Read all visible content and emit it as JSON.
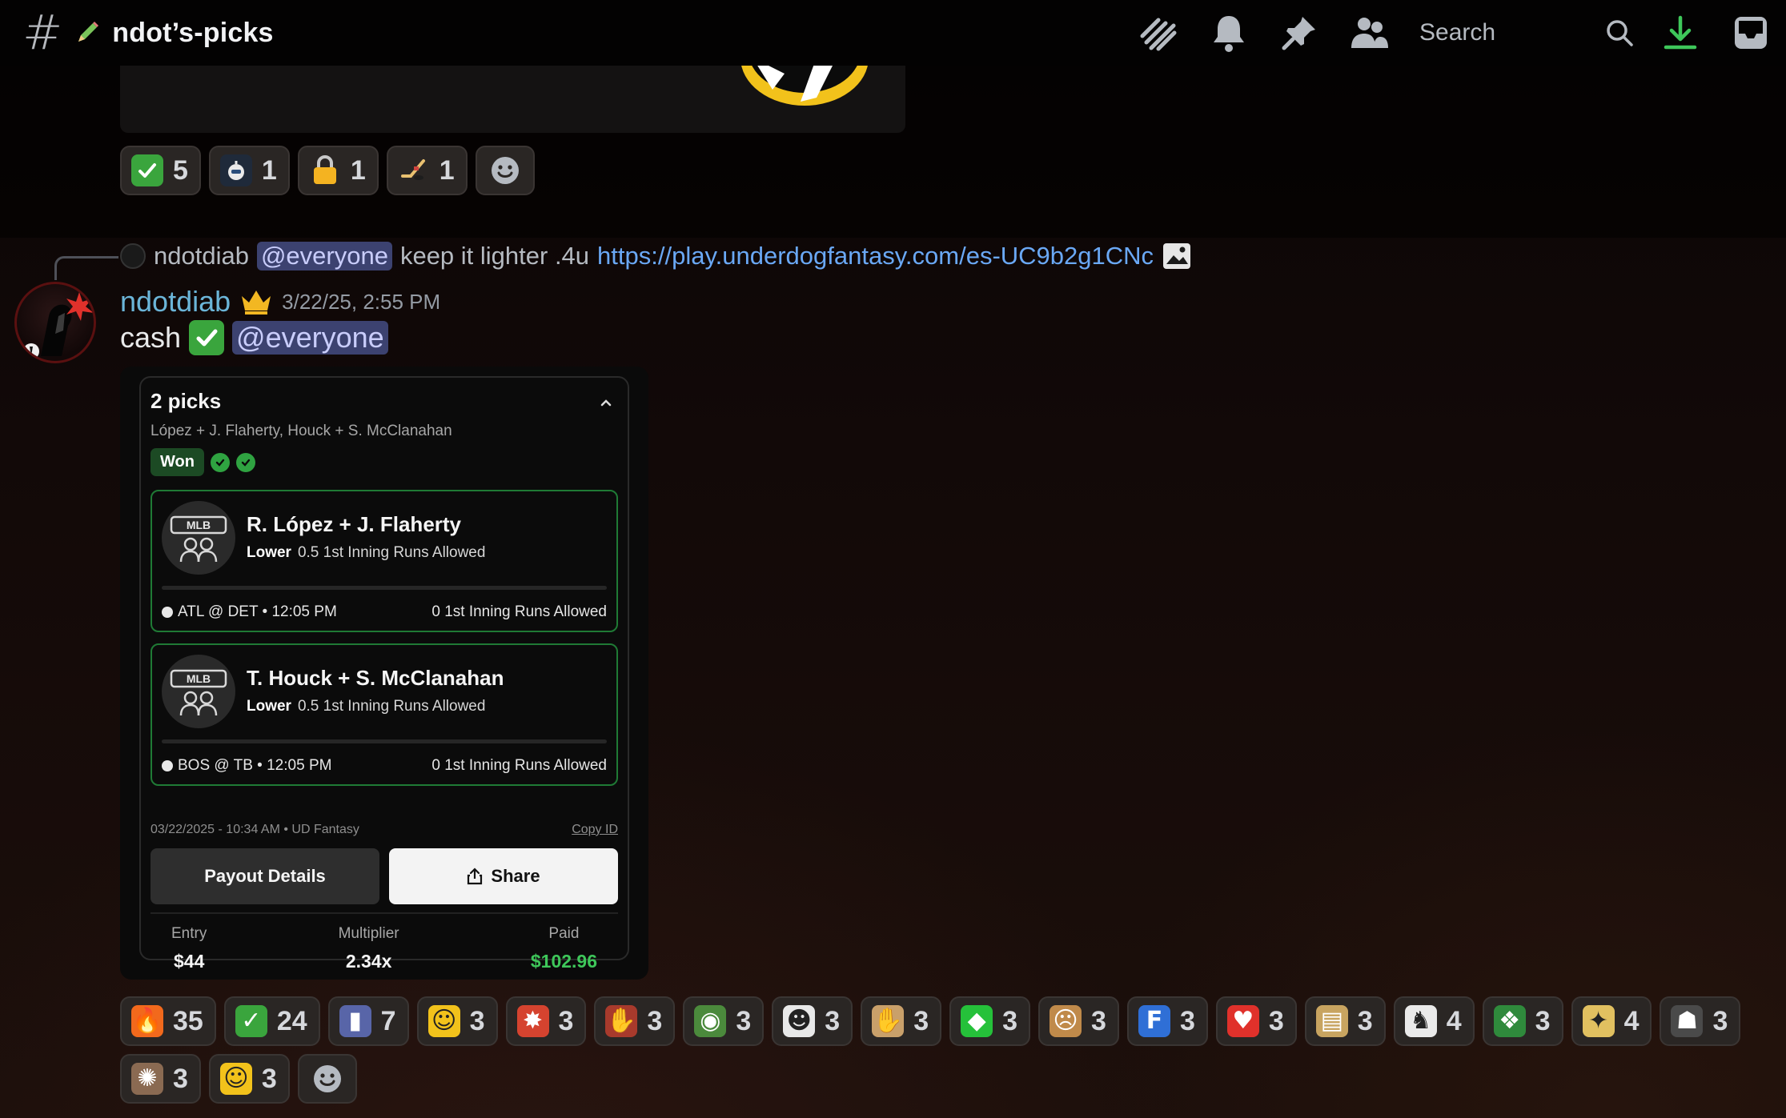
{
  "header": {
    "channel_name": "ndot’s-picks",
    "search_placeholder": "Search",
    "icons": [
      "threads-icon",
      "bell-icon",
      "pin-icon",
      "members-icon",
      "search-icon",
      "download-icon",
      "inbox-icon"
    ]
  },
  "prev_reactions": [
    {
      "icon": "check-mark-icon",
      "count": "5"
    },
    {
      "icon": "robot-icon",
      "count": "1"
    },
    {
      "icon": "lock-icon",
      "count": "1"
    },
    {
      "icon": "hockey-stick-icon",
      "count": "1"
    }
  ],
  "reply": {
    "author": "ndotdiab",
    "mention": "@everyone",
    "text": "keep it lighter .4u",
    "link": "https://play.underdogfantasy.com/es-UC9b2g1CNc"
  },
  "message": {
    "author": "ndotdiab",
    "timestamp": "3/22/25, 2:55 PM",
    "text": "cash",
    "mention": "@everyone"
  },
  "card": {
    "title": "2 picks",
    "subtitle": "López + J. Flaherty, Houck + S. McClanahan",
    "status": "Won",
    "picks": [
      {
        "logo": "MLB",
        "name": "R. López + J. Flaherty",
        "direction": "Lower",
        "line": "0.5 1st Inning Runs Allowed",
        "game": "ATL @ DET • 12:05 PM",
        "result": "0 1st Inning Runs Allowed"
      },
      {
        "logo": "MLB",
        "name": "T. Houck + S. McClanahan",
        "direction": "Lower",
        "line": "0.5 1st Inning Runs Allowed",
        "game": "BOS @ TB • 12:05 PM",
        "result": "0 1st Inning Runs Allowed"
      }
    ],
    "meta": "03/22/2025 - 10:34 AM • UD Fantasy",
    "copy_id": "Copy ID",
    "payout_button": "Payout Details",
    "share_button": "Share",
    "entry_label": "Entry",
    "entry_value": "$44",
    "multiplier_label": "Multiplier",
    "multiplier_value": "2.34x",
    "paid_label": "Paid",
    "paid_value": "$102.96"
  },
  "reactions": [
    {
      "icon": "fire-icon",
      "count": "35"
    },
    {
      "icon": "check-mark-icon",
      "count": "24"
    },
    {
      "icon": "notebook-icon",
      "count": "7"
    },
    {
      "icon": "face-emoji-icon",
      "count": "3"
    },
    {
      "icon": "bang-icon",
      "count": "3"
    },
    {
      "icon": "hand-emoji-icon",
      "count": "3"
    },
    {
      "icon": "pepe-icon",
      "count": "3"
    },
    {
      "icon": "chef-icon",
      "count": "3"
    },
    {
      "icon": "praying-hands-icon",
      "count": "3"
    },
    {
      "icon": "green-gem-icon",
      "count": "3"
    },
    {
      "icon": "screaming-face-icon",
      "count": "3"
    },
    {
      "icon": "free-icon",
      "count": "3"
    },
    {
      "icon": "fire-heart-icon",
      "count": "3"
    },
    {
      "icon": "money-stack-icon",
      "count": "3"
    },
    {
      "icon": "goat-icon",
      "count": "4"
    },
    {
      "icon": "money-dragon-icon",
      "count": "3"
    },
    {
      "icon": "dancing-figure-icon",
      "count": "4"
    },
    {
      "icon": "portrait-icon",
      "count": "3"
    },
    {
      "icon": "explosion-icon",
      "count": "3"
    },
    {
      "icon": "shocked-face-icon",
      "count": "3"
    }
  ]
}
